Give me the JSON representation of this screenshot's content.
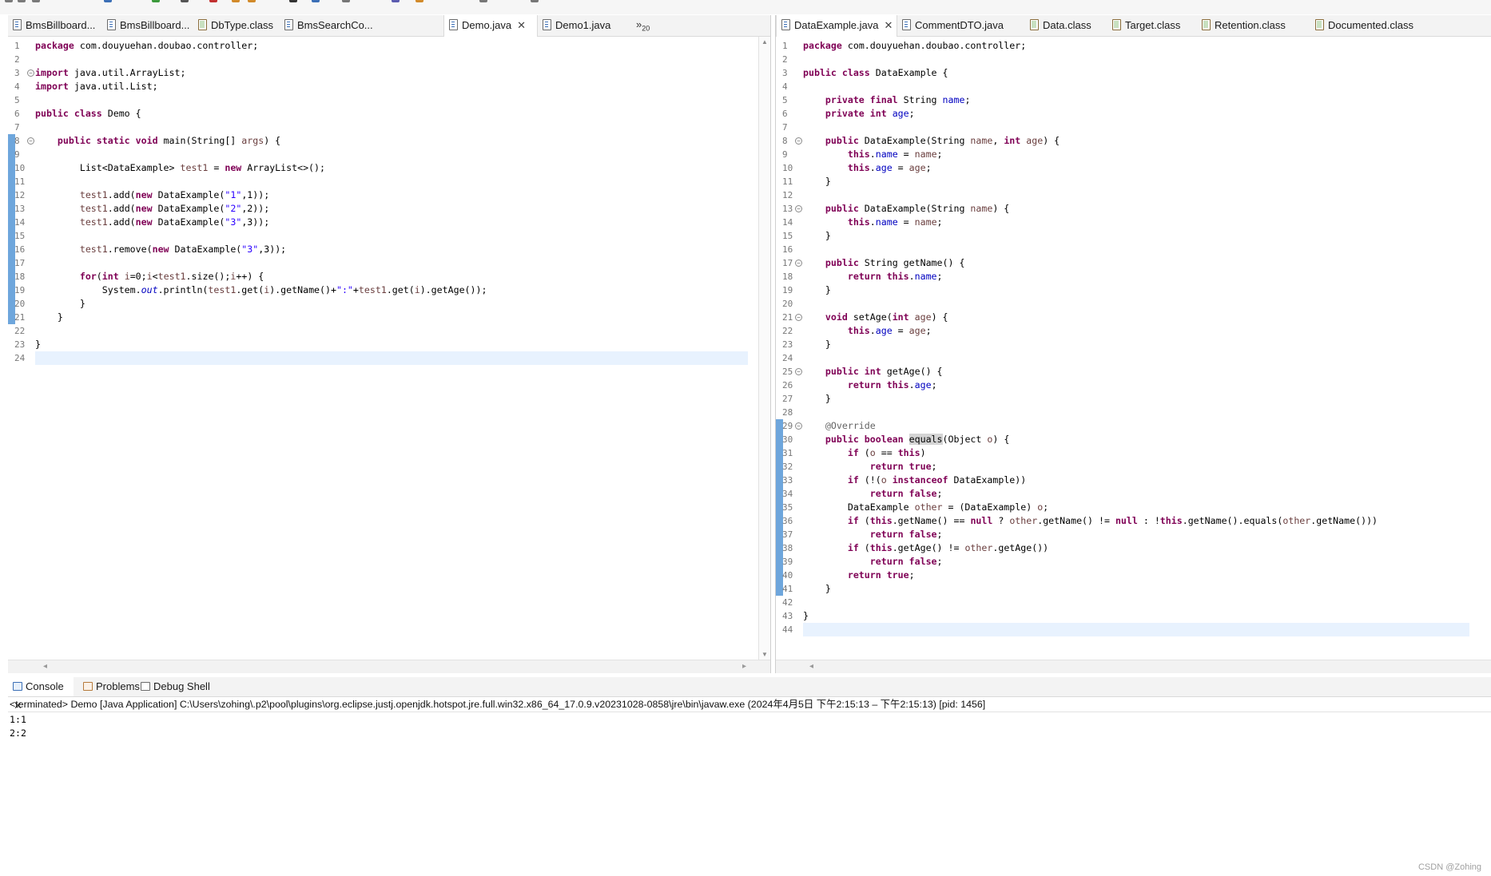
{
  "colors": {
    "keyword": "#7f0055",
    "field": "#0000c0",
    "string": "#2a00ff",
    "local_variable": "#6a3e3e",
    "annotation": "#646464",
    "change_marker": "#6ea6dc",
    "current_line": "#e8f2fe"
  },
  "left_editor": {
    "tabs": [
      {
        "label": "BmsBillboard...",
        "icon": "java-file-icon"
      },
      {
        "label": "BmsBillboard...",
        "icon": "java-file-icon"
      },
      {
        "label": "DbType.class",
        "icon": "class-file-icon"
      },
      {
        "label": "BmsSearchCo...",
        "icon": "java-file-icon"
      },
      {
        "label": "Demo.java",
        "icon": "java-file-icon",
        "active": true
      },
      {
        "label": "Demo1.java",
        "icon": "java-file-icon"
      }
    ],
    "overflow_label": "»",
    "overflow_count": "20",
    "line_numbers": [
      "1",
      "2",
      "3",
      "4",
      "5",
      "6",
      "7",
      "8",
      "9",
      "10",
      "11",
      "12",
      "13",
      "14",
      "15",
      "16",
      "17",
      "18",
      "19",
      "20",
      "21",
      "22",
      "23",
      "24"
    ],
    "lines": [
      "<span class=\"kw\">package</span> com.douyuehan.doubao.controller;",
      "",
      "<span class=\"kw\">import</span> java.util.ArrayList;",
      "<span class=\"kw\">import</span> java.util.List;",
      "",
      "<span class=\"kw\">public class</span> Demo {",
      "",
      "    <span class=\"kw\">public static void</span> main(String[] <span class=\"var\">args</span>) {",
      "",
      "        List&lt;DataExample&gt; <span class=\"var\">test1</span> = <span class=\"kw\">new</span> ArrayList&lt;&gt;();",
      "",
      "        <span class=\"var\">test1</span>.add(<span class=\"kw\">new</span> DataExample(<span class=\"str\">\"1\"</span>,1));",
      "        <span class=\"var\">test1</span>.add(<span class=\"kw\">new</span> DataExample(<span class=\"str\">\"2\"</span>,2));",
      "        <span class=\"var\">test1</span>.add(<span class=\"kw\">new</span> DataExample(<span class=\"str\">\"3\"</span>,3));",
      "",
      "        <span class=\"var\">test1</span>.remove(<span class=\"kw\">new</span> DataExample(<span class=\"str\">\"3\"</span>,3));",
      "",
      "        <span class=\"kw\">for</span>(<span class=\"kw\">int</span> <span class=\"var\">i</span>=0;<span class=\"var\">i</span>&lt;<span class=\"var\">test1</span>.size();<span class=\"var\">i</span>++) {",
      "            System.<span class=\"fld\"><i>out</i></span>.println(<span class=\"var\">test1</span>.get(<span class=\"var\">i</span>).getName()+<span class=\"str\">\":\"</span>+<span class=\"var\">test1</span>.get(<span class=\"var\">i</span>).getAge());",
      "        }",
      "    }",
      "",
      "}",
      ""
    ]
  },
  "right_editor": {
    "tabs": [
      {
        "label": "DataExample.java",
        "icon": "java-file-icon",
        "active": true
      },
      {
        "label": "CommentDTO.java",
        "icon": "java-file-icon"
      },
      {
        "label": "Data.class",
        "icon": "class-file-icon"
      },
      {
        "label": "Target.class",
        "icon": "class-file-icon"
      },
      {
        "label": "Retention.class",
        "icon": "class-file-icon"
      },
      {
        "label": "Documented.class",
        "icon": "class-file-icon"
      }
    ],
    "line_numbers": [
      "1",
      "2",
      "3",
      "4",
      "5",
      "6",
      "7",
      "8",
      "9",
      "10",
      "11",
      "12",
      "13",
      "14",
      "15",
      "16",
      "17",
      "18",
      "19",
      "20",
      "21",
      "22",
      "23",
      "24",
      "25",
      "26",
      "27",
      "28",
      "29",
      "30",
      "31",
      "32",
      "33",
      "34",
      "35",
      "36",
      "37",
      "38",
      "39",
      "40",
      "41",
      "42",
      "43",
      "44"
    ],
    "lines": [
      "<span class=\"kw\">package</span> com.douyuehan.doubao.controller;",
      "",
      "<span class=\"kw\">public class</span> DataExample {",
      "",
      "    <span class=\"kw\">private final</span> String <span class=\"fld\">name</span>;",
      "    <span class=\"kw\">private int</span> <span class=\"fld\">age</span>;",
      "",
      "    <span class=\"kw\">public</span> DataExample(String <span class=\"var\">name</span>, <span class=\"kw\">int</span> <span class=\"var\">age</span>) {",
      "        <span class=\"kw\">this</span>.<span class=\"fld\">name</span> = <span class=\"var\">name</span>;",
      "        <span class=\"kw\">this</span>.<span class=\"fld\">age</span> = <span class=\"var\">age</span>;",
      "    }",
      "",
      "    <span class=\"kw\">public</span> DataExample(String <span class=\"var\">name</span>) {",
      "        <span class=\"kw\">this</span>.<span class=\"fld\">name</span> = <span class=\"var\">name</span>;",
      "    }",
      "",
      "    <span class=\"kw\">public</span> String getName() {",
      "        <span class=\"kw\">return this</span>.<span class=\"fld\">name</span>;",
      "    }",
      "",
      "    <span class=\"kw\">void</span> setAge(<span class=\"kw\">int</span> <span class=\"var\">age</span>) {",
      "        <span class=\"kw\">this</span>.<span class=\"fld\">age</span> = <span class=\"var\">age</span>;",
      "    }",
      "",
      "    <span class=\"kw\">public int</span> getAge() {",
      "        <span class=\"kw\">return this</span>.<span class=\"fld\">age</span>;",
      "    }",
      "",
      "    <span class=\"ann\">@Override</span>",
      "    <span class=\"kw\">public boolean</span> <span class=\"occ\">equals</span>(Object <span class=\"var\">o</span>) {",
      "        <span class=\"kw\">if</span> (<span class=\"var\">o</span> == <span class=\"kw\">this</span>)",
      "            <span class=\"kw\">return true</span>;",
      "        <span class=\"kw\">if</span> (!(<span class=\"var\">o</span> <span class=\"kw\">instanceof</span> DataExample))",
      "            <span class=\"kw\">return false</span>;",
      "        DataExample <span class=\"var\">other</span> = (DataExample) <span class=\"var\">o</span>;",
      "        <span class=\"kw\">if</span> (<span class=\"kw\">this</span>.getName() == <span class=\"kw\">null</span> ? <span class=\"var\">other</span>.getName() != <span class=\"kw\">null</span> : !<span class=\"kw\">this</span>.getName().equals(<span class=\"var\">other</span>.getName()))",
      "            <span class=\"kw\">return false</span>;",
      "        <span class=\"kw\">if</span> (<span class=\"kw\">this</span>.getAge() != <span class=\"var\">other</span>.getAge())",
      "            <span class=\"kw\">return false</span>;",
      "        <span class=\"kw\">return true</span>;",
      "    }",
      "",
      "}",
      ""
    ]
  },
  "console": {
    "tabs": [
      {
        "label": "Console",
        "icon": "console-icon",
        "active": true
      },
      {
        "label": "Problems",
        "icon": "problems-icon"
      },
      {
        "label": "Debug Shell",
        "icon": "debug-shell-icon"
      }
    ],
    "header": "<terminated> Demo [Java Application] C:\\Users\\zohing\\.p2\\pool\\plugins\\org.eclipse.justj.openjdk.hotspot.jre.full.win32.x86_64_17.0.9.v20231028-0858\\jre\\bin\\javaw.exe  (2024年4月5日 下午2:15:13 – 下午2:15:13) [pid: 1456]",
    "output": [
      "1:1",
      "2:2"
    ]
  },
  "watermark": "CSDN @Zohing"
}
